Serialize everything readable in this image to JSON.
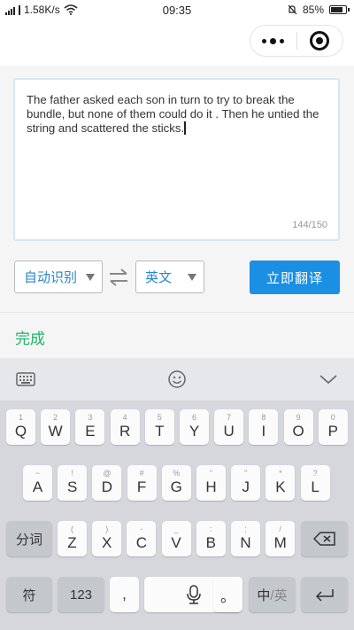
{
  "status_bar": {
    "network_speed": "1.58K/s",
    "time": "09:35",
    "battery": "85%",
    "battery_level": 0.85
  },
  "editor": {
    "text": "The father asked each son in turn to try to break the bundle, but none of them could do it . Then he untied the string and scattered the sticks.",
    "counter": "144/150"
  },
  "controls": {
    "source_lang": "自动识别",
    "target_lang": "英文",
    "translate_label": "立即翻译"
  },
  "done_label": "完成",
  "keyboard": {
    "row1": [
      {
        "sub": "1",
        "main": "Q"
      },
      {
        "sub": "2",
        "main": "W"
      },
      {
        "sub": "3",
        "main": "E"
      },
      {
        "sub": "4",
        "main": "R"
      },
      {
        "sub": "5",
        "main": "T"
      },
      {
        "sub": "6",
        "main": "Y"
      },
      {
        "sub": "7",
        "main": "U"
      },
      {
        "sub": "8",
        "main": "I"
      },
      {
        "sub": "9",
        "main": "O"
      },
      {
        "sub": "0",
        "main": "P"
      }
    ],
    "row2": [
      {
        "sub": "~",
        "main": "A"
      },
      {
        "sub": "!",
        "main": "S"
      },
      {
        "sub": "@",
        "main": "D"
      },
      {
        "sub": "#",
        "main": "F"
      },
      {
        "sub": "%",
        "main": "G"
      },
      {
        "sub": "\"",
        "main": "H"
      },
      {
        "sub": "\"",
        "main": "J"
      },
      {
        "sub": "*",
        "main": "K"
      },
      {
        "sub": "?",
        "main": "L"
      }
    ],
    "row3": [
      {
        "sub": "(",
        "main": "Z"
      },
      {
        "sub": ")",
        "main": "X"
      },
      {
        "sub": "-",
        "main": "C"
      },
      {
        "sub": "_",
        "main": "V"
      },
      {
        "sub": ":",
        "main": "B"
      },
      {
        "sub": ";",
        "main": "N"
      },
      {
        "sub": "/",
        "main": "M"
      }
    ],
    "fenci_label": "分词",
    "symbol_label": "符",
    "num_label": "123",
    "comma_label": ",",
    "period_label": "。",
    "lang_toggle_zh": "中",
    "lang_toggle_en": "/英"
  }
}
